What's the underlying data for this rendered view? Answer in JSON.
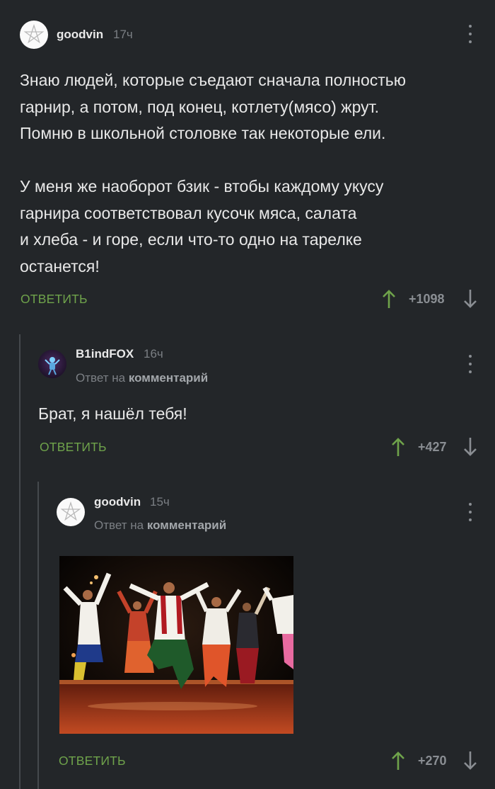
{
  "comments": [
    {
      "username": "goodvin",
      "time": "17ч",
      "paragraphs": [
        [
          "Знаю людей, которые съедают сначала полностью",
          "гарнир, а потом, под конец, котлету(мясо) жрут.",
          "Помню в школьной столовке так некоторые ели."
        ],
        [
          "У меня же наоборот бзик - втобы каждому укусу",
          "гарнира соответствовал кусочк мяса, салата",
          "и хлеба - и горе, если что-то одно на тарелке",
          "останется!"
        ]
      ],
      "reply_label": "ОТВЕТИТЬ",
      "rating": "+1098"
    },
    {
      "username": "B1indFOX",
      "time": "16ч",
      "reply_to_prefix": "Ответ на",
      "reply_to_link": "комментарий",
      "text": "Брат, я нашёл тебя!",
      "reply_label": "ОТВЕТИТЬ",
      "rating": "+427"
    },
    {
      "username": "goodvin",
      "time": "15ч",
      "reply_to_prefix": "Ответ на",
      "reply_to_link": "комментарий",
      "reply_label": "ОТВЕТИТЬ",
      "rating": "+270"
    }
  ],
  "icons": {
    "more": "kebab-icon",
    "upvote": "arrow-up-icon",
    "downvote": "arrow-down-icon"
  },
  "colors": {
    "background": "#232629",
    "accent": "#6fa34b",
    "muted": "#7b7f84"
  }
}
